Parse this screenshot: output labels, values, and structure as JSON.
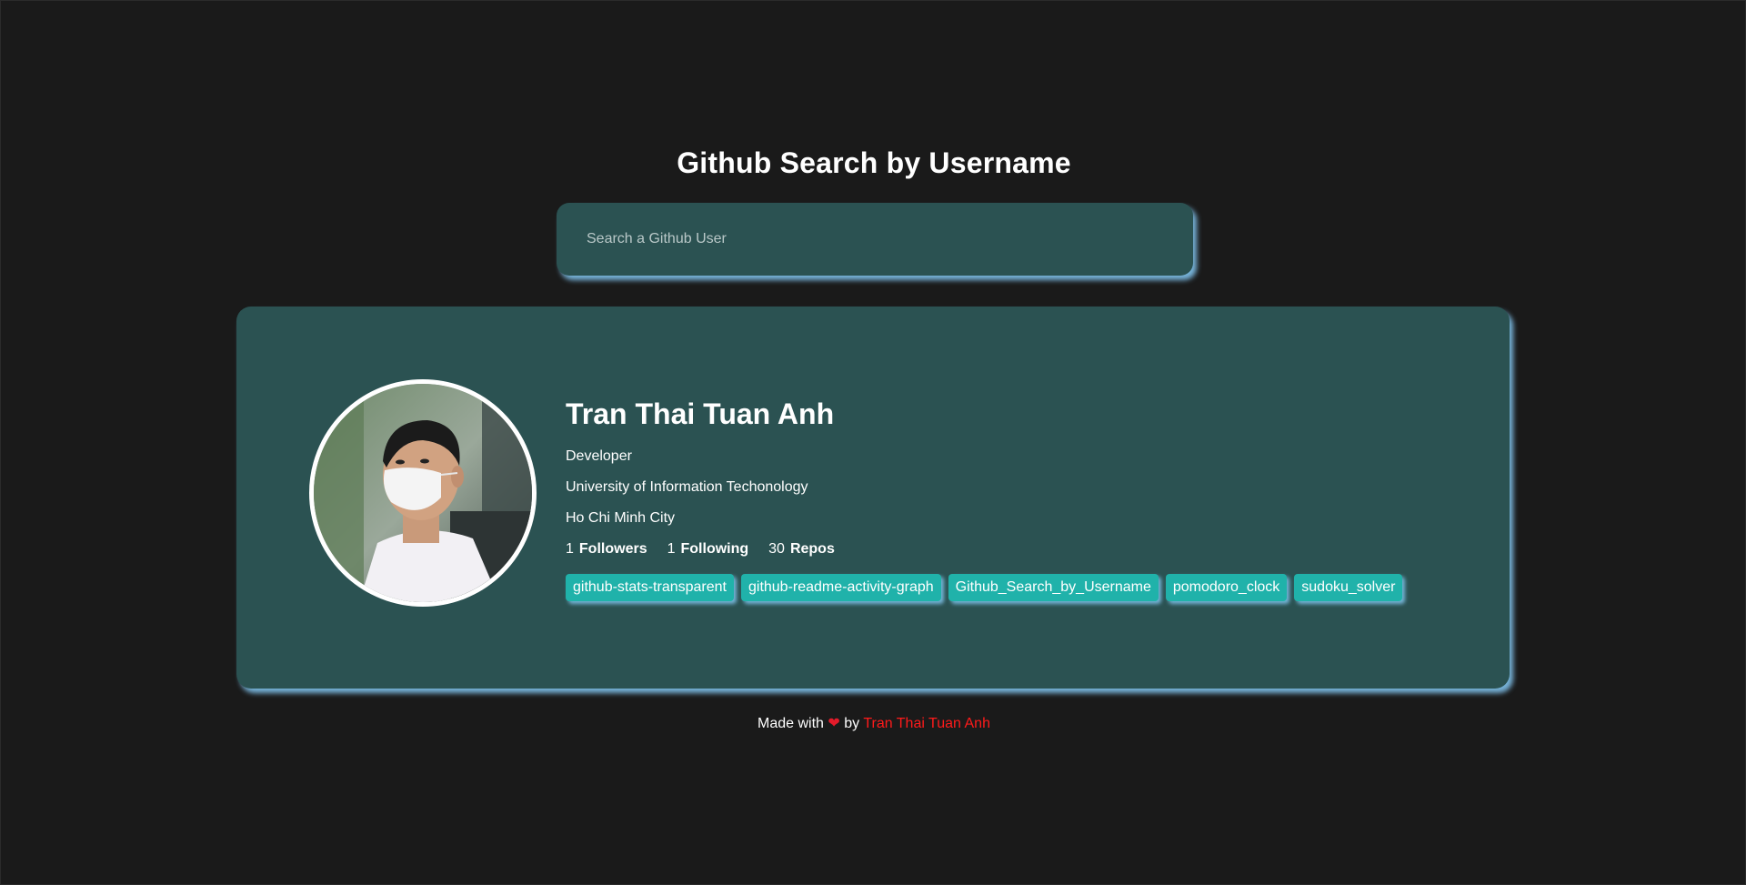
{
  "header": {
    "title": "Github Search by Username"
  },
  "search": {
    "placeholder": "Search a Github User",
    "value": ""
  },
  "profile": {
    "name": "Tran Thai Tuan Anh",
    "bio": "Developer",
    "company": "University of Information Techonology",
    "location": "Ho Chi Minh City",
    "followers_count": "1",
    "followers_label": "Followers",
    "following_count": "1",
    "following_label": "Following",
    "repos_count": "30",
    "repos_label": "Repos",
    "avatar_icon": "user-photo-avatar"
  },
  "repos": [
    "github-stats-transparent",
    "github-readme-activity-graph",
    "Github_Search_by_Username",
    "pomodoro_clock",
    "sudoku_solver"
  ],
  "footer": {
    "made_with": "Made with",
    "heart": "❤",
    "by": "by",
    "author": "Tran Thai Tuan Anh"
  },
  "colors": {
    "background": "#1a1a1a",
    "card": "#2b5252",
    "repo_tag": "#20b2aa",
    "shadow": "#87cefa",
    "author_link": "#ff1a1a"
  }
}
